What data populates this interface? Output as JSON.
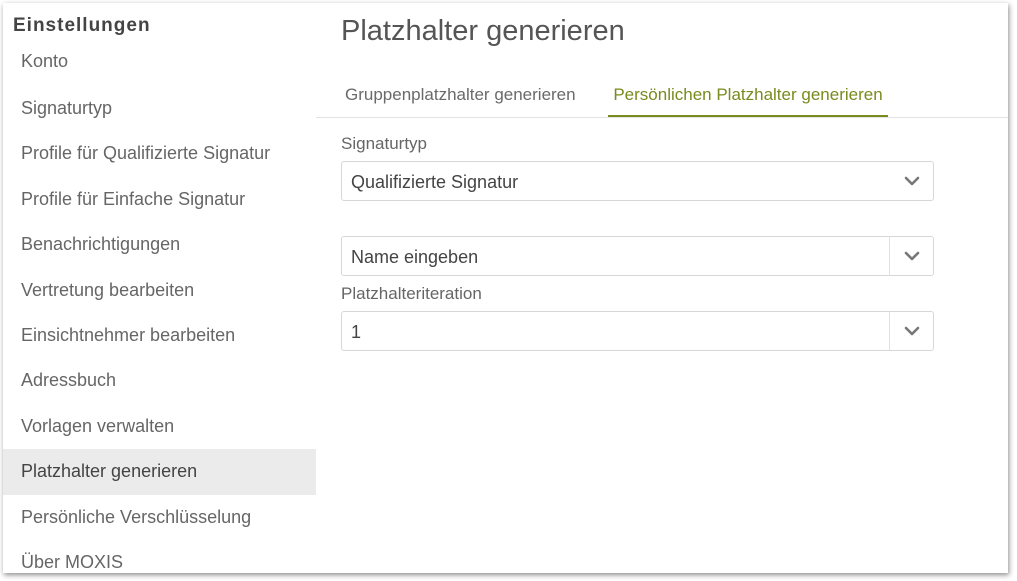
{
  "sidebar": {
    "title": "Einstellungen",
    "items": [
      {
        "label": "Konto"
      },
      {
        "label": "Signaturtyp"
      },
      {
        "label": "Profile für Qualifizierte Signatur"
      },
      {
        "label": "Profile für Einfache Signatur"
      },
      {
        "label": "Benachrichtigungen"
      },
      {
        "label": "Vertretung bearbeiten"
      },
      {
        "label": "Einsichtnehmer bearbeiten"
      },
      {
        "label": "Adressbuch"
      },
      {
        "label": "Vorlagen verwalten"
      },
      {
        "label": "Platzhalter generieren",
        "active": true
      },
      {
        "label": "Persönliche Verschlüsselung"
      },
      {
        "label": "Über MOXIS"
      }
    ]
  },
  "main": {
    "title": "Platzhalter generieren",
    "tabs": [
      {
        "label": "Gruppenplatzhalter generieren",
        "active": false
      },
      {
        "label": "Persönlichen Platzhalter generieren",
        "active": true
      }
    ],
    "signature_type": {
      "label": "Signaturtyp",
      "value": "Qualifizierte Signatur",
      "icon": "chevron-down-icon"
    },
    "name_select": {
      "value": "Name eingeben",
      "icon": "chevron-down-icon"
    },
    "iteration": {
      "label": "Platzhalteriteration",
      "value": "1",
      "icon": "chevron-down-icon"
    }
  },
  "colors": {
    "accent": "#7a8a1e",
    "active_item_bg": "#ebebeb",
    "border": "#d7d7d7"
  }
}
